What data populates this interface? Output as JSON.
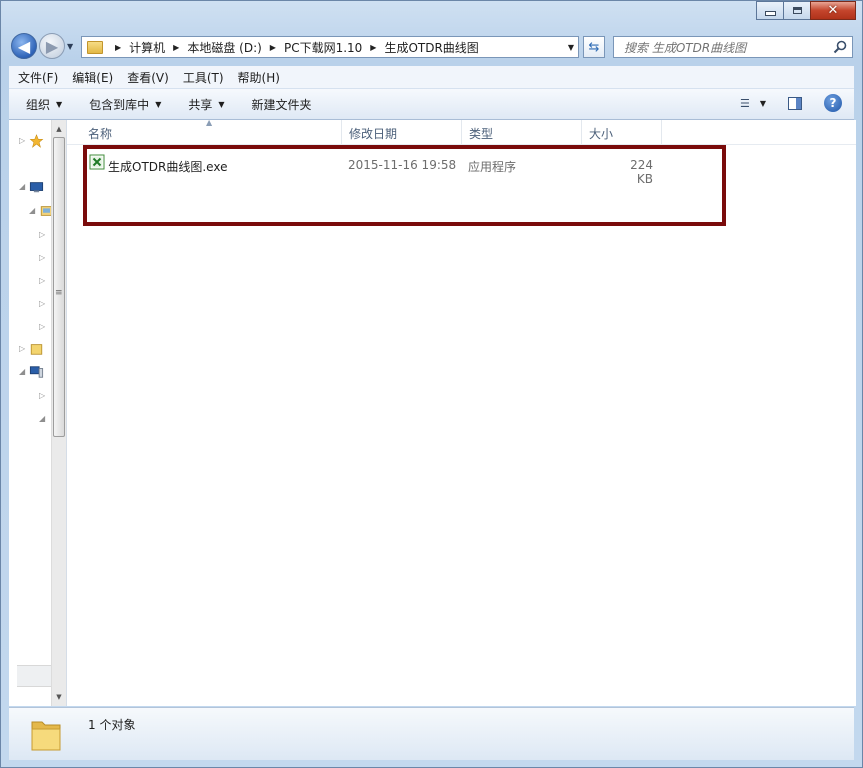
{
  "window": {
    "title_buttons": [
      "minimize",
      "maximize",
      "close"
    ]
  },
  "nav": {
    "breadcrumbs": [
      "计算机",
      "本地磁盘 (D:)",
      "PC下载网1.10",
      "生成OTDR曲线图"
    ]
  },
  "search": {
    "placeholder": "搜索 生成OTDR曲线图"
  },
  "menu": [
    "文件(F)",
    "编辑(E)",
    "查看(V)",
    "工具(T)",
    "帮助(H)"
  ],
  "toolbar": {
    "organize": "组织",
    "include_library": "包含到库中",
    "share": "共享",
    "new_folder": "新建文件夹"
  },
  "columns": {
    "name": "名称",
    "date": "修改日期",
    "type": "类型",
    "size": "大小"
  },
  "files": [
    {
      "name": "生成OTDR曲线图.exe",
      "date": "2015-11-16 19:58",
      "type": "应用程序",
      "size": "224 KB"
    }
  ],
  "status": {
    "text": "1 个对象"
  },
  "colors": {
    "highlight_border": "#7a0b0b",
    "accent": "#2f64b8"
  }
}
